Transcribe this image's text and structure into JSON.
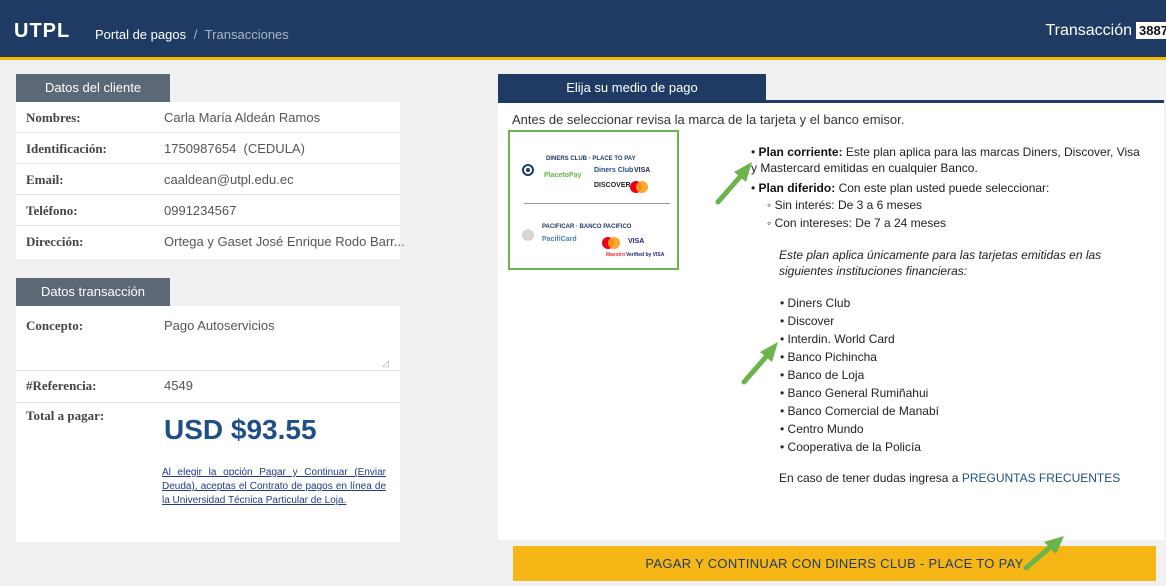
{
  "header": {
    "brand": "UTPL",
    "breadcrumb": {
      "portal": "Portal de pagos",
      "separator": "/",
      "current": "Transacciones"
    },
    "transaction_label": "Transacción",
    "transaction_number": "3887"
  },
  "client": {
    "tab": "Datos del cliente",
    "rows": [
      {
        "label": "Nombres:",
        "value": "Carla María Aldeán Ramos"
      },
      {
        "label": "Identificación:",
        "value": "1750987654  (CEDULA)"
      },
      {
        "label": "Email:",
        "value": "caaldean@utpl.edu.ec"
      },
      {
        "label": "Teléfono:",
        "value": "0991234567"
      },
      {
        "label": "Dirección:",
        "value": "Ortega y Gaset José Enrique Rodo Barr..."
      }
    ]
  },
  "transaction": {
    "tab": "Datos transacción",
    "concept_label": "Concepto:",
    "concept_value": "Pago Autoservicios",
    "reference_label": "#Referencia:",
    "reference_value": "4549",
    "total_label": "Total a pagar:",
    "total_value": "USD $93.55",
    "legal_text": "Al elegir la opción Pagar y Continuar (Enviar Deuda), aceptas el Contrato de pagos en línea de la Universidad Técnica Particular de Loja."
  },
  "payment": {
    "tab": "Elija su medio de pago",
    "intro": "Antes de seleccionar revisa la marca de la tarjeta y el banco emisor.",
    "options": [
      {
        "label": "DINERS CLUB · PLACE TO PAY",
        "selected": true,
        "logos": [
          "PlacetoPay",
          "Diners Club",
          "VISA",
          "DISCOVER",
          "mastercard"
        ]
      },
      {
        "label": "PACIFICAR · BANCO PACIFICO",
        "selected": false,
        "logos": [
          "PacifiCard",
          "mastercard",
          "VISA",
          "Maestro",
          "Verified by VISA"
        ]
      }
    ],
    "plan_corriente_title": "Plan corriente:",
    "plan_corriente_text": "Este plan aplica para las marcas Diners, Discover, Visa y Mastercard emitidas en cualquier Banco.",
    "plan_diferido_title": "Plan diferido:",
    "plan_diferido_text": "Con este plan usted puede seleccionar:",
    "sub_options": [
      "Sin interés: De 3 a 6 meses",
      "Con intereses: De 7 a 24 meses"
    ],
    "institutions_note": "Este plan aplica únicamente para las tarjetas emitidas en las siguientes instituciones financieras:",
    "institutions": [
      "Diners Club",
      "Discover",
      "Interdin. World Card",
      "Banco Pichincha",
      "Banco de Loja",
      "Banco General Rumiñahui",
      "Banco Comercial de Manabí",
      "Centro Mundo",
      "Cooperativa de la Policía"
    ],
    "faq_text": "En caso de tener dudas ingresa a",
    "faq_link": "PREGUNTAS FRECUENTES",
    "pay_button": "PAGAR Y CONTINUAR CON DINERS CLUB - PLACE TO PAY"
  },
  "colors": {
    "header": "#1f3b63",
    "accent": "#f5b800",
    "tab": "#5d6877",
    "pay_button": "#f6b716",
    "highlight": "#6bb34a"
  }
}
